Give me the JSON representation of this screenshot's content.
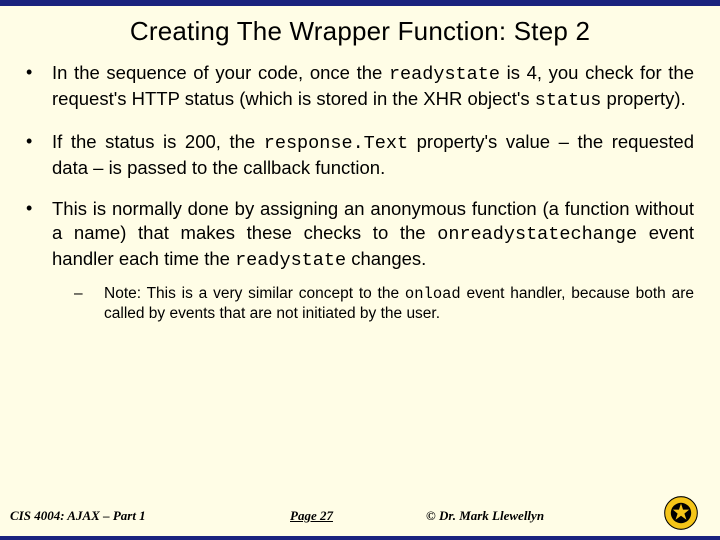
{
  "title": "Creating The Wrapper Function: Step 2",
  "bullets": {
    "b1_a": "In the sequence of your code, once the ",
    "b1_code1": "readystate",
    "b1_b": " is 4, you check for the request's HTTP status (which is stored in the XHR object's ",
    "b1_code2": "status",
    "b1_c": " property).",
    "b2_a": "If the status is 200, the ",
    "b2_code1": "response.Text",
    "b2_b": " property's value – the requested data – is passed to the callback function.",
    "b3_a": "This is normally done by assigning an anonymous function (a function without a name) that makes these checks to the ",
    "b3_code1": "onreadystatechange",
    "b3_b": " event handler each time the ",
    "b3_code2": "readystate",
    "b3_c": " changes.",
    "sub1_a": "Note: This is a very similar concept to the ",
    "sub1_code1": "onload",
    "sub1_b": " event handler, because both are called by events that are not initiated by the user."
  },
  "footer": {
    "course": "CIS 4004: AJAX – Part 1",
    "page": "Page 27",
    "author": "© Dr. Mark Llewellyn"
  }
}
